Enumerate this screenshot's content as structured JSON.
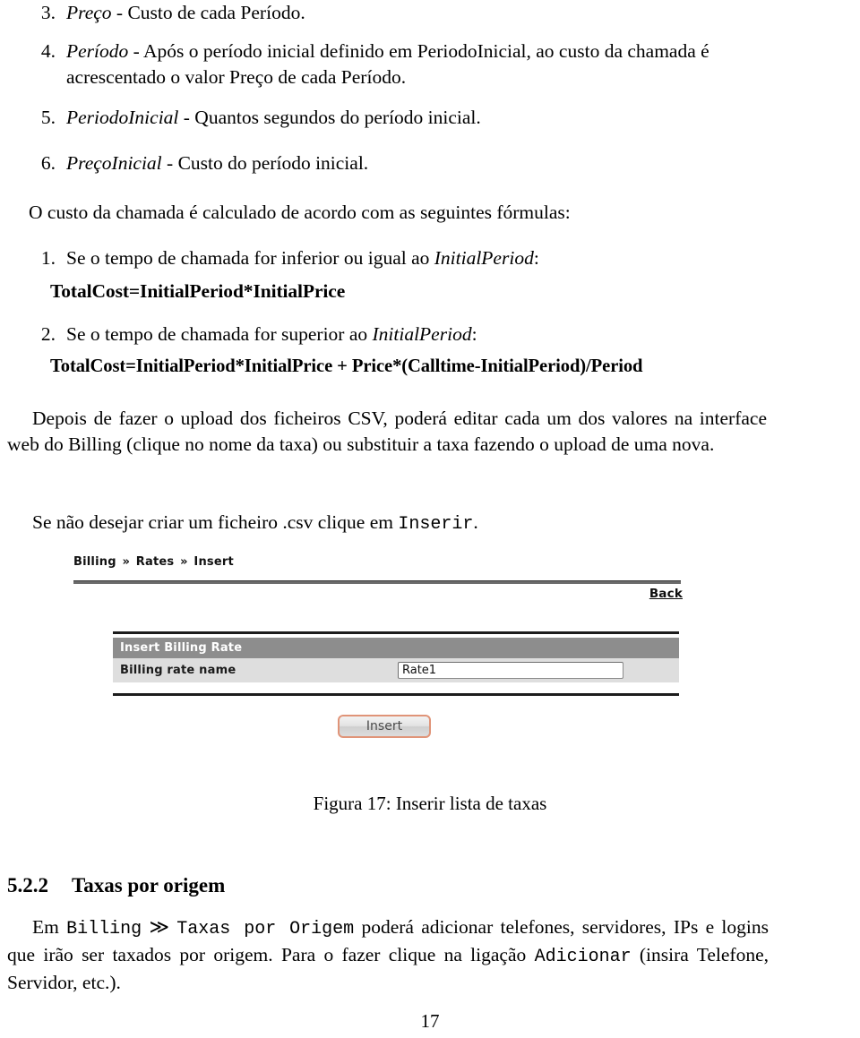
{
  "document": {
    "page_number": "17",
    "lists": {
      "parameters": [
        {
          "number": "3.",
          "term": "Preço",
          "rest": " - Custo de cada Período."
        },
        {
          "number": "4.",
          "term": "Período",
          "rest": " - Após o período inicial definido em PeriodoInicial, ao custo da chamada é acrescentado o valor Preço de cada Período."
        },
        {
          "number": "5.",
          "term": "PeriodoInicial",
          "rest": " - Quantos segundos do período inicial."
        },
        {
          "number": "6.",
          "term": "PreçoInicial",
          "rest": " - Custo do período inicial."
        }
      ],
      "formulas_intro": "O custo da chamada é calculado de acordo com as seguintes fórmulas:",
      "formulas": [
        {
          "number": "1.",
          "lead": "Se o tempo de chamada for inferior ou igual ao ",
          "term": "InitialPeriod",
          "tail": ":",
          "equation": "TotalCost=InitialPeriod*InitialPrice"
        },
        {
          "number": "2.",
          "lead": "Se o tempo de chamada for superior ao ",
          "term": "InitialPeriod",
          "tail": ":",
          "equation": "TotalCost=InitialPeriod*InitialPrice + Price*(Calltime-InitialPeriod)/Period"
        }
      ]
    },
    "paragraphs": {
      "upload_note": "Depois de fazer o upload dos ficheiros CSV, poderá editar cada um dos valores na interface web do Billing (clique no nome da taxa) ou substituir a taxa fazendo o upload de uma nova.",
      "insert_note_pre": "Se não desejar criar um ficheiro .csv clique em ",
      "insert_note_code": "Inserir",
      "insert_note_post": "."
    },
    "figure": {
      "caption_label": "Figura 17:",
      "caption_text": "Inserir lista de taxas"
    },
    "section": {
      "number": "5.2.2",
      "title": "Taxas por origem",
      "body_pre": "Em ",
      "body_code1": "Billing",
      "body_sep": "≫",
      "body_code2": "Taxas por Origem",
      "body_mid": " poderá adicionar telefones, servidores, IPs e logins que irão ser taxados por origem.  Para o fazer clique na ligação ",
      "body_code3": "Adicionar",
      "body_post": " (insira Telefone, Servidor, etc.)."
    }
  },
  "app_screenshot": {
    "breadcrumb": {
      "items": [
        "Billing",
        "Rates",
        "Insert"
      ],
      "separator": "»"
    },
    "back_link": "Back",
    "table": {
      "header": "Insert Billing Rate",
      "rows": [
        {
          "label": "Billing rate name",
          "value": "Rate1"
        }
      ]
    },
    "submit_button": "Insert",
    "colors": {
      "header_row_bg": "#8d8d8d",
      "body_row_bg": "#dedede",
      "button_border": "#e09478",
      "rule": "#1c1c1c"
    }
  }
}
